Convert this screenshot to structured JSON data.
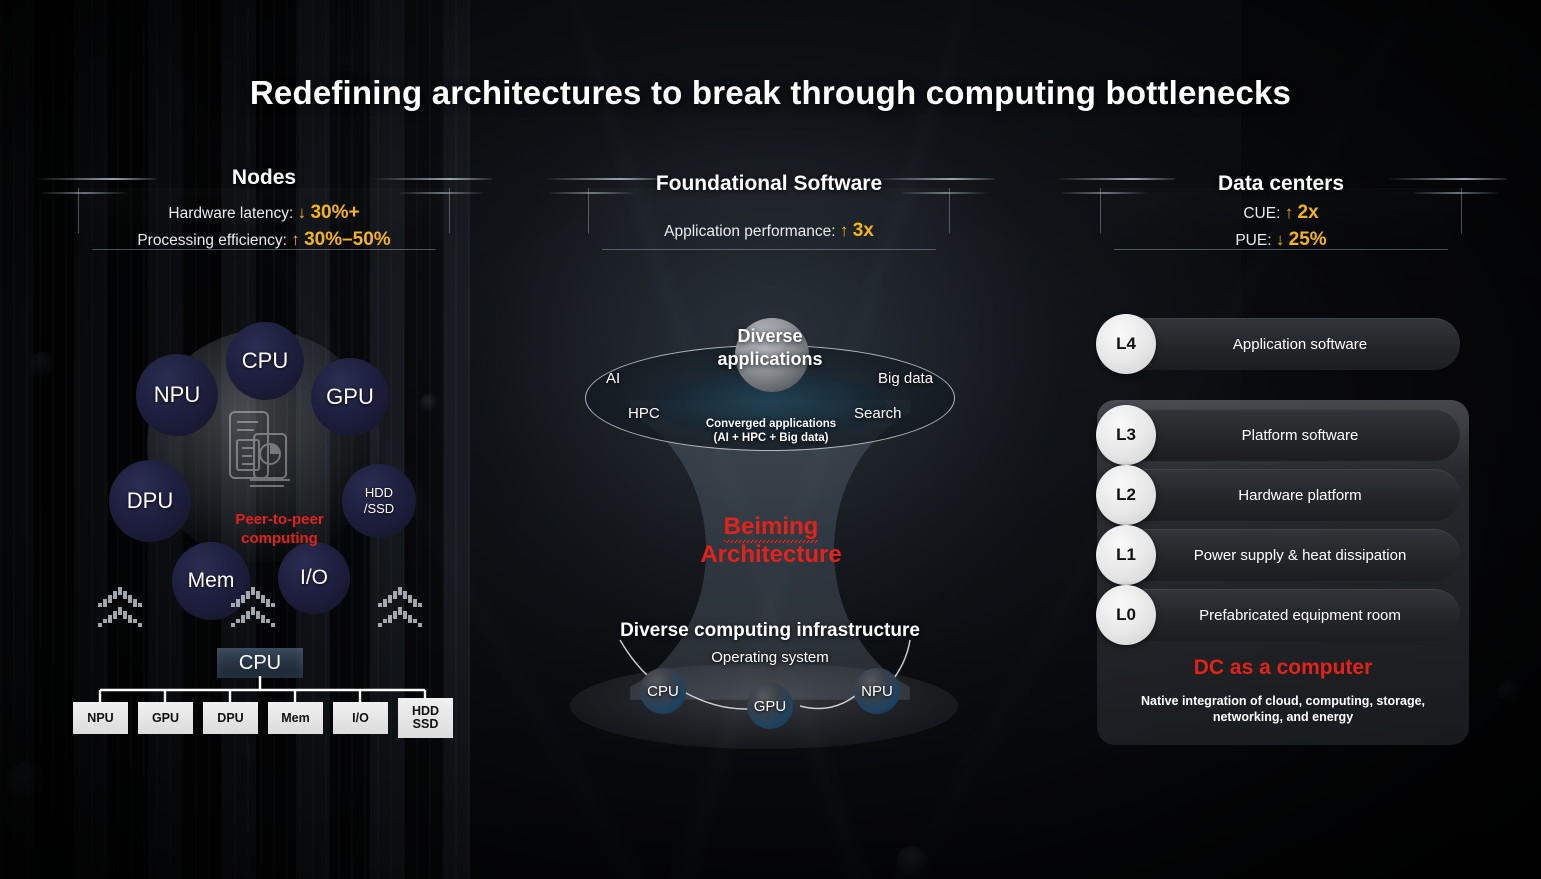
{
  "title": "Redefining architectures to break through computing bottlenecks",
  "colors": {
    "accent_yellow": "#f5b41b",
    "accent_red": "#e2231a",
    "node_navy": "#1d1f3e",
    "text_white": "#ffffff",
    "panel_grey": "#2b2e33"
  },
  "sections": {
    "nodes": {
      "title": "Nodes",
      "metrics": [
        {
          "label": "Hardware latency:",
          "arrow": "↓",
          "value": "30%+"
        },
        {
          "label": "Processing efficiency:",
          "arrow": "↑",
          "value": "30%–50%"
        }
      ],
      "ring": {
        "center_label": "Peer-to-peer\ncomputing",
        "center_line1": "Peer-to-peer",
        "center_line2": "computing",
        "center_icon": "mobile-analytics-icon",
        "nodes": [
          {
            "label": "CPU"
          },
          {
            "label": "GPU"
          },
          {
            "label": "HDD\n/SSD",
            "line1": "HDD",
            "line2": "/SSD"
          },
          {
            "label": "I/O"
          },
          {
            "label": "Mem"
          },
          {
            "label": "DPU"
          },
          {
            "label": "NPU"
          }
        ]
      },
      "tree": {
        "root": "CPU",
        "leaves": [
          {
            "line1": "NPU",
            "line2": ""
          },
          {
            "line1": "GPU",
            "line2": ""
          },
          {
            "line1": "DPU",
            "line2": ""
          },
          {
            "line1": "Mem",
            "line2": ""
          },
          {
            "line1": "I/O",
            "line2": ""
          },
          {
            "line1": "HDD",
            "line2": "SSD"
          }
        ]
      }
    },
    "foundational_software": {
      "title": "Foundational Software",
      "metrics": [
        {
          "label": "Application performance:",
          "arrow": "↑",
          "value": "3x"
        }
      ],
      "top": {
        "headline_line1": "Diverse",
        "headline_line2": "applications",
        "ring_labels": {
          "left_top": "AI",
          "left_bottom": "HPC",
          "right_top": "Big data",
          "right_bottom": "Search"
        },
        "caption_line1": "Converged applications",
        "caption_line2": "(AI + HPC + Big data)"
      },
      "middle": {
        "name_line1": "Beiming",
        "name_line2": "Architecture"
      },
      "bottom": {
        "headline": "Diverse computing infrastructure",
        "subhead": "Operating system",
        "chips": [
          "CPU",
          "GPU",
          "NPU"
        ]
      }
    },
    "data_centers": {
      "title": "Data centers",
      "metrics": [
        {
          "label": "CUE:",
          "arrow": "↑",
          "value": "2x"
        },
        {
          "label": "PUE:",
          "arrow": "↓",
          "value": "25%"
        }
      ],
      "layers": [
        {
          "cap": "L4",
          "text": "Application software"
        },
        {
          "cap": "L3",
          "text": "Platform software"
        },
        {
          "cap": "L2",
          "text": "Hardware platform"
        },
        {
          "cap": "L1",
          "text": "Power supply & heat dissipation"
        },
        {
          "cap": "L0",
          "text": "Prefabricated equipment room"
        }
      ],
      "footer": {
        "headline": "DC as a computer",
        "sub_line1": "Native integration of cloud, computing, storage,",
        "sub_line2": "networking, and energy"
      }
    }
  }
}
